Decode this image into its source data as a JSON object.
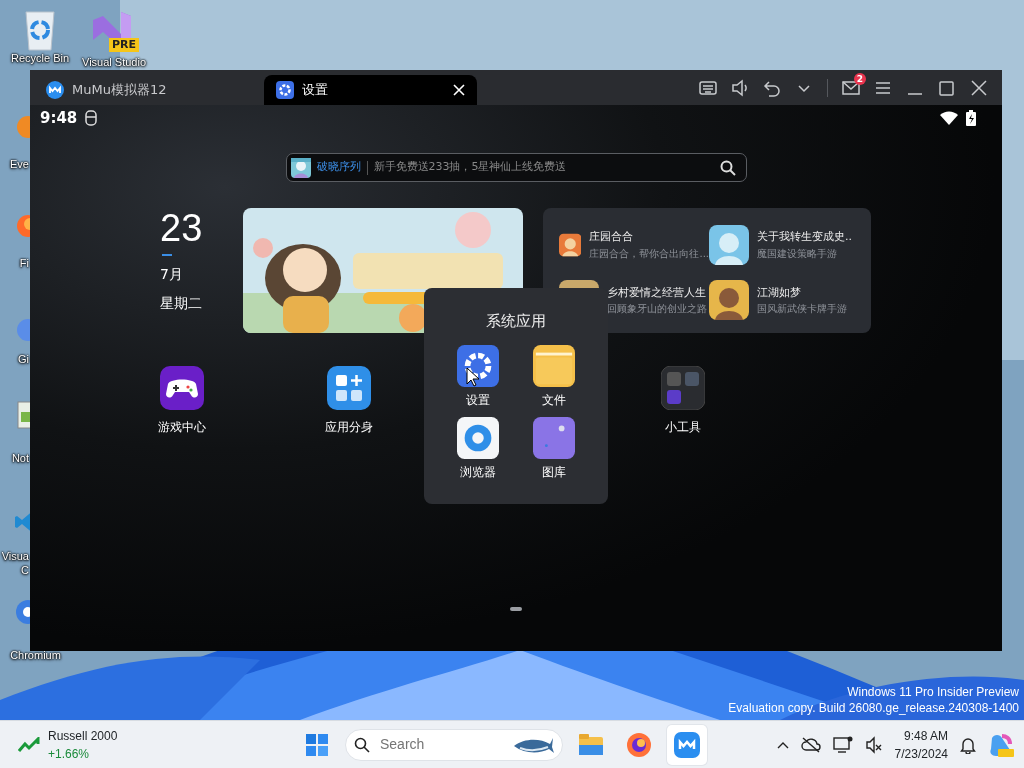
{
  "desktop": {
    "top_icons": [
      {
        "label": "Recycle Bin",
        "kind": "recycle"
      },
      {
        "label": "Visual Studio",
        "kind": "vs",
        "badge": "PRE"
      }
    ],
    "side_icons": [
      {
        "lines": [
          "Eve"
        ],
        "kind": "orange"
      },
      {
        "lines": [
          "Fi"
        ],
        "kind": "firefox"
      },
      {
        "lines": [
          "Gi"
        ],
        "kind": "blue"
      },
      {
        "lines": [
          "Not"
        ],
        "kind": "notepad"
      },
      {
        "lines": [
          "Visua",
          "C"
        ],
        "kind": "vscode"
      },
      {
        "lines": [
          "Chromium"
        ],
        "kind": "chromium"
      }
    ],
    "watermark_lines": [
      "Windows 11 Pro Insider Preview",
      "Evaluation copy. Build 26080.ge_release.240308-1400"
    ]
  },
  "emulator": {
    "tabs": [
      {
        "label": "MuMu模拟器12",
        "selected": false,
        "kind": "mumu"
      },
      {
        "label": "设置",
        "selected": true,
        "kind": "settings"
      }
    ],
    "mail_badge": "2"
  },
  "android": {
    "status_time": "9:48",
    "search": {
      "game": "破晓序列",
      "text": "新手免费送233抽，5星神仙上线免费送"
    },
    "clock": {
      "day": "23",
      "month": "7月",
      "weekday": "星期二"
    },
    "games": [
      {
        "title": "庄园合合",
        "subtitle": "庄园合合，帮你合出向往..."
      },
      {
        "title": "关于我转生变成史..",
        "subtitle": "魔国建设策略手游"
      },
      {
        "title": "乡村爱情之经营人生",
        "subtitle": "回顾象牙山的创业之路"
      },
      {
        "title": "江湖如梦",
        "subtitle": "国风新武侠卡牌手游"
      }
    ],
    "apps": [
      {
        "label": "游戏中心",
        "kind": "gamepad"
      },
      {
        "label": "应用分身",
        "kind": "clone"
      },
      {
        "label": "小工具",
        "kind": "folder"
      }
    ],
    "folder": {
      "title": "系统应用",
      "apps": [
        {
          "label": "设置",
          "kind": "settings"
        },
        {
          "label": "文件",
          "kind": "files"
        },
        {
          "label": "浏览器",
          "kind": "browser"
        },
        {
          "label": "图库",
          "kind": "gallery"
        }
      ]
    }
  },
  "taskbar": {
    "widget": {
      "title": "Russell 2000",
      "change": "+1.66%"
    },
    "search_placeholder": "Search",
    "apps": [
      {
        "kind": "explorer",
        "selected": false
      },
      {
        "kind": "firefox",
        "selected": false
      },
      {
        "kind": "mumu",
        "selected": true
      }
    ],
    "time": "9:48 AM",
    "date": "7/23/2024"
  }
}
